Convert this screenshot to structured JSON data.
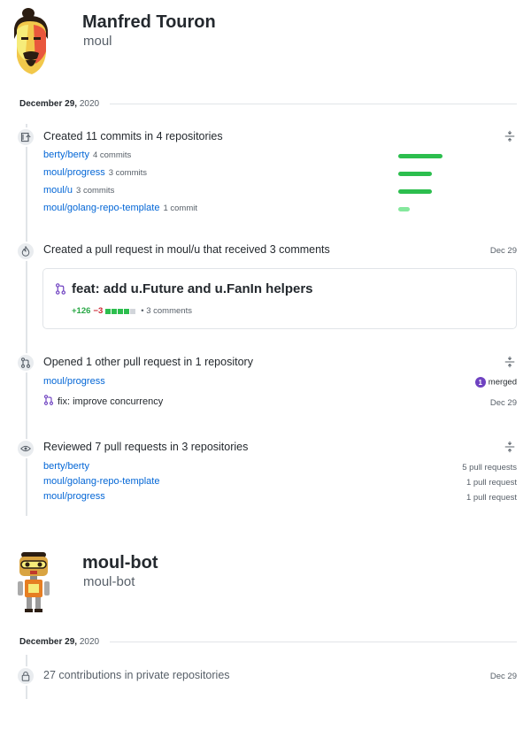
{
  "user1": {
    "name": "Manfred Touron",
    "login": "moul",
    "date_bold": "December 29,",
    "date_year": "2020",
    "commits": {
      "title": "Created 11 commits in 4 repositories",
      "repos": [
        {
          "name": "berty/berty",
          "count": "4 commits",
          "fraction": 1.0
        },
        {
          "name": "moul/progress",
          "count": "3 commits",
          "fraction": 0.75
        },
        {
          "name": "moul/u",
          "count": "3 commits",
          "fraction": 0.75
        },
        {
          "name": "moul/golang-repo-template",
          "count": "1 commit",
          "fraction": 0.25
        }
      ]
    },
    "pull_request": {
      "title": "Created a pull request in moul/u that received 3 comments",
      "date": "Dec 29",
      "card_title": "feat: add u.Future and u.FanIn helpers",
      "additions": "+126",
      "deletions": "−3",
      "comments": "• 3 comments"
    },
    "other_pr": {
      "title": "Opened 1 other pull request in 1 repository",
      "repo": "moul/progress",
      "merged_count": "1",
      "merged_label": "merged",
      "pr_title": "fix: improve concurrency",
      "date": "Dec 29"
    },
    "reviewed": {
      "title": "Reviewed 7 pull requests in 3 repositories",
      "repos": [
        {
          "name": "berty/berty",
          "count": "5 pull requests"
        },
        {
          "name": "moul/golang-repo-template",
          "count": "1 pull request"
        },
        {
          "name": "moul/progress",
          "count": "1 pull request"
        }
      ]
    }
  },
  "user2": {
    "name": "moul-bot",
    "login": "moul-bot",
    "date_bold": "December 29,",
    "date_year": "2020",
    "private": {
      "title": "27 contributions in private repositories",
      "date": "Dec 29"
    }
  },
  "colors": {
    "link": "#0366d6",
    "bar": "#2cbe4e",
    "bar_light": "#85e89d",
    "merged": "#6f42c1",
    "add": "#28a745",
    "del": "#cb2431"
  }
}
